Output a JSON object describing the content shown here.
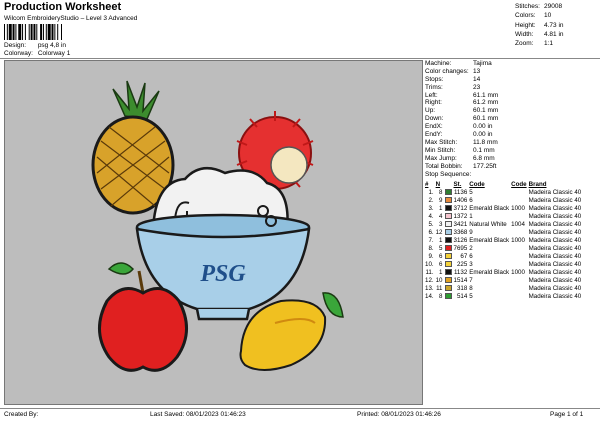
{
  "header": {
    "title": "Production Worksheet",
    "subtitle": "Wilcom EmbroideryStudio – Level 3 Advanced",
    "design_label": "Design:",
    "design_value": "psg 4,8 in",
    "colorway_label": "Colorway:",
    "colorway_value": "Colorway 1"
  },
  "summary": [
    {
      "k": "Stitches:",
      "v": "29008"
    },
    {
      "k": "Colors:",
      "v": "10"
    },
    {
      "k": "Height:",
      "v": "4.73 in"
    },
    {
      "k": "Width:",
      "v": "4.81 in"
    },
    {
      "k": "Zoom:",
      "v": "1:1"
    }
  ],
  "machine_info": [
    {
      "k": "Machine:",
      "v": "Tajima"
    },
    {
      "k": "Color changes:",
      "v": "13"
    },
    {
      "k": "Stops:",
      "v": "14"
    },
    {
      "k": "Trims:",
      "v": "23"
    },
    {
      "k": "Left:",
      "v": "61.1 mm"
    },
    {
      "k": "Right:",
      "v": "61.2 mm"
    },
    {
      "k": "Up:",
      "v": "60.1 mm"
    },
    {
      "k": "Down:",
      "v": "60.1 mm"
    },
    {
      "k": "EndX:",
      "v": "0.00 in"
    },
    {
      "k": "EndY:",
      "v": "0.00 in"
    },
    {
      "k": "Max Stitch:",
      "v": "11.8 mm"
    },
    {
      "k": "Min Stitch:",
      "v": "0.1 mm"
    },
    {
      "k": "Max Jump:",
      "v": "6.8 mm"
    },
    {
      "k": "Total Bobbin:",
      "v": "177.25ft"
    }
  ],
  "stop_sequence": {
    "title": "Stop Sequence:",
    "columns": [
      "#",
      "N",
      "",
      "St.",
      "Code",
      "Code",
      "Brand"
    ],
    "rows": [
      {
        "idx": "1.",
        "n": "8",
        "color": "#2e7d32",
        "st": "1136",
        "code": "5",
        "code2": "",
        "brand": "Madeira Classic 40"
      },
      {
        "idx": "2.",
        "n": "9",
        "color": "#e8893a",
        "st": "1406",
        "code": "6",
        "code2": "",
        "brand": "Madeira Classic 40"
      },
      {
        "idx": "3.",
        "n": "1",
        "color": "#111111",
        "st": "3712",
        "code": "Emerald Black",
        "code2": "1000",
        "brand": "Madeira Classic 40"
      },
      {
        "idx": "4.",
        "n": "4",
        "color": "#f6c6cf",
        "st": "1372",
        "code": "1",
        "code2": "",
        "brand": "Madeira Classic 40"
      },
      {
        "idx": "5.",
        "n": "3",
        "color": "#f2f2f2",
        "st": "3421",
        "code": "Natural White",
        "code2": "1004",
        "brand": "Madeira Classic 40"
      },
      {
        "idx": "6.",
        "n": "12",
        "color": "#a8cfe8",
        "st": "3368",
        "code": "9",
        "code2": "",
        "brand": "Madeira Classic 40"
      },
      {
        "idx": "7.",
        "n": "1",
        "color": "#111111",
        "st": "3126",
        "code": "Emerald Black",
        "code2": "1000",
        "brand": "Madeira Classic 40"
      },
      {
        "idx": "8.",
        "n": "5",
        "color": "#e02020",
        "st": "7695",
        "code": "2",
        "code2": "",
        "brand": "Madeira Classic 40"
      },
      {
        "idx": "9.",
        "n": "6",
        "color": "#f4d23a",
        "st": "67",
        "code": "6",
        "code2": "",
        "brand": "Madeira Classic 40"
      },
      {
        "idx": "10.",
        "n": "6",
        "color": "#f4d23a",
        "st": "225",
        "code": "3",
        "code2": "",
        "brand": "Madeira Classic 40"
      },
      {
        "idx": "11.",
        "n": "1",
        "color": "#111111",
        "st": "1132",
        "code": "Emerald Black",
        "code2": "1000",
        "brand": "Madeira Classic 40"
      },
      {
        "idx": "12.",
        "n": "10",
        "color": "#e0a020",
        "st": "1514",
        "code": "7",
        "code2": "",
        "brand": "Madeira Classic 40"
      },
      {
        "idx": "13.",
        "n": "11",
        "color": "#c9a42a",
        "st": "318",
        "code": "8",
        "code2": "",
        "brand": "Madeira Classic 40"
      },
      {
        "idx": "14.",
        "n": "8",
        "color": "#2e9d32",
        "st": "514",
        "code": "5",
        "code2": "",
        "brand": "Madeira Classic 40"
      }
    ]
  },
  "design_preview": {
    "bowl_text": "PSG",
    "colors": {
      "background": "#bdbdbd",
      "bowl": "#a8cfe8",
      "rice": "#f2f2f2",
      "apple": "#e02020",
      "mango": "#f0c020",
      "leaf": "#3aa63a",
      "pineapple": "#d8a22a",
      "rambutan": "#e53030"
    }
  },
  "footer": {
    "created_by": "Created By:",
    "last_saved": "Last Saved: 08/01/2023 01:46:23",
    "printed": "Printed: 08/01/2023 01:46:26",
    "page": "Page 1 of 1"
  }
}
